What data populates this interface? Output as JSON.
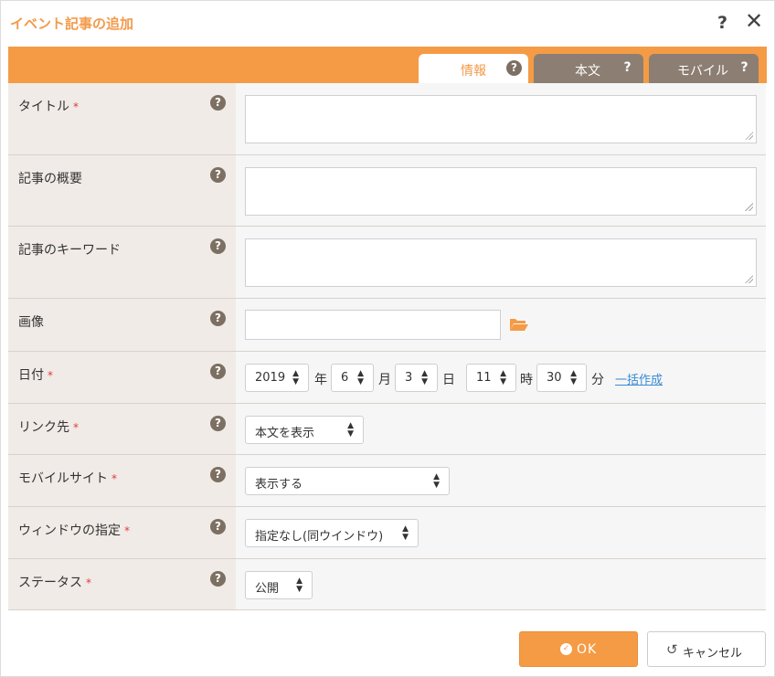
{
  "dialog": {
    "title": "イベント記事の追加",
    "help_label": "?",
    "close_label": "✕"
  },
  "tabs": [
    {
      "label": "情報",
      "help": "?",
      "active": true
    },
    {
      "label": "本文",
      "help": "?"
    },
    {
      "label": "モバイル",
      "help": "?"
    }
  ],
  "form": {
    "required_mark": "*",
    "help": "?",
    "title_label": "タイトル",
    "summary_label": "記事の概要",
    "keyword_label": "記事のキーワード",
    "image_label": "画像",
    "date_label": "日付",
    "link_label": "リンク先",
    "mobile_label": "モバイルサイト",
    "window_label": "ウィンドウの指定",
    "status_label": "ステータス",
    "title_value": "",
    "summary_value": "",
    "keyword_value": "",
    "image_value": "",
    "date": {
      "year": "2019",
      "year_unit": "年",
      "month": "6",
      "month_unit": "月",
      "day": "3",
      "day_unit": "日",
      "hour": "11",
      "hour_unit": "時",
      "minute": "30",
      "minute_unit": "分",
      "bulk_link": "一括作成"
    },
    "link_value": "本文を表示",
    "mobile_value": "表示する",
    "window_value": "指定なし(同ウインドウ)",
    "status_value": "公開"
  },
  "buttons": {
    "ok_label": "OK",
    "cancel_label": "キャンセル"
  },
  "colors": {
    "accent": "#f59b45",
    "tab_inactive": "#8c7e72",
    "label_bg": "#f0ebe6",
    "required": "#e0393e",
    "link": "#3a8bd6"
  }
}
